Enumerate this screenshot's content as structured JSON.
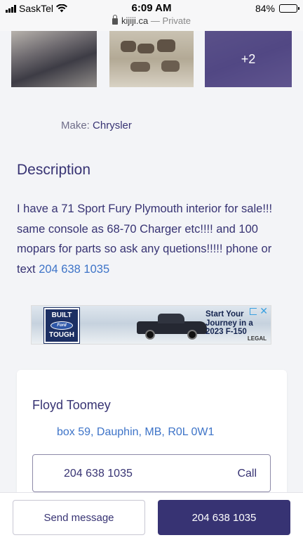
{
  "status_bar": {
    "carrier": "SaskTel",
    "time": "6:09 AM",
    "battery": "84%",
    "battery_level": 0.84
  },
  "browser": {
    "domain": "kijiji.ca",
    "separator": "—",
    "mode": "Private"
  },
  "gallery": {
    "more_count": "+2"
  },
  "details": {
    "make_label": "Make:",
    "make_value": "Chrysler"
  },
  "description": {
    "title": "Description",
    "text": "I have a 71 Sport Fury Plymouth interior for sale!!! same console as 68-70 Charger etc!!!! and 100 mopars for parts so ask any quetions!!!!! phone or text ",
    "phone_link": "204 638 1035"
  },
  "ad": {
    "badge_top": "BUILT",
    "badge_logo": "Ford",
    "badge_bottom": "TOUGH",
    "headline_1": "Start Your",
    "headline_2": "Journey in a",
    "headline_3": "2023 F-150",
    "legal": "LEGAL",
    "close": "✕"
  },
  "seller": {
    "name": "Floyd Toomey",
    "address": "box 59, Dauphin, MB, R0L 0W1",
    "phone": "204 638 1035",
    "call_label": "Call"
  },
  "actions": {
    "send_message": "Send message",
    "phone_button": "204 638 1035"
  },
  "colors": {
    "primary": "#373373",
    "link": "#3e74c8",
    "background": "#f3f4f7"
  }
}
